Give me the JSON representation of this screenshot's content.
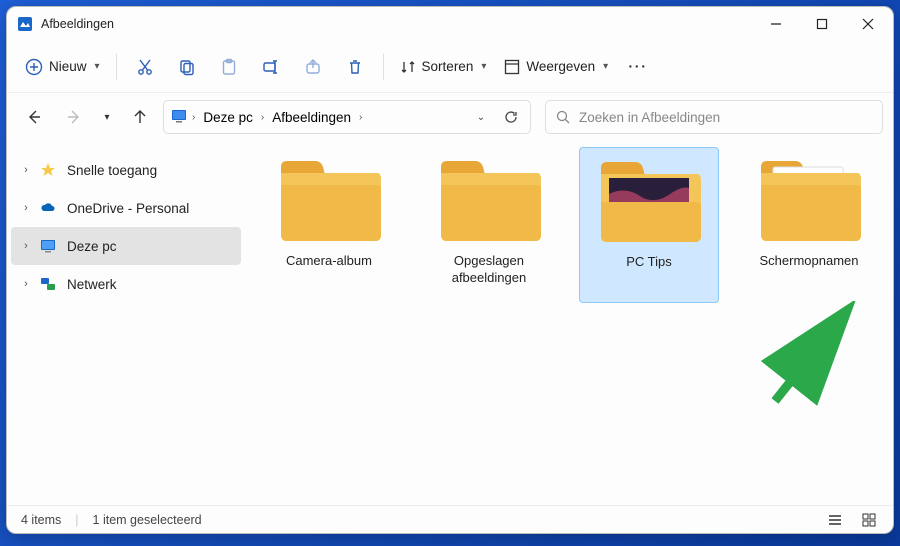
{
  "title": "Afbeeldingen",
  "toolbar": {
    "new": "Nieuw",
    "sort": "Sorteren",
    "view": "Weergeven"
  },
  "breadcrumb": {
    "pc": "Deze pc",
    "folder": "Afbeeldingen"
  },
  "search": {
    "placeholder": "Zoeken in Afbeeldingen"
  },
  "sidebar": {
    "quick": "Snelle toegang",
    "onedrive": "OneDrive - Personal",
    "pc": "Deze pc",
    "network": "Netwerk"
  },
  "folders": {
    "camera": "Camera-album",
    "saved": "Opgeslagen afbeeldingen",
    "pctips": "PC Tips",
    "screenshots": "Schermopnamen"
  },
  "status": {
    "count": "4 items",
    "selected": "1 item geselecteerd"
  }
}
